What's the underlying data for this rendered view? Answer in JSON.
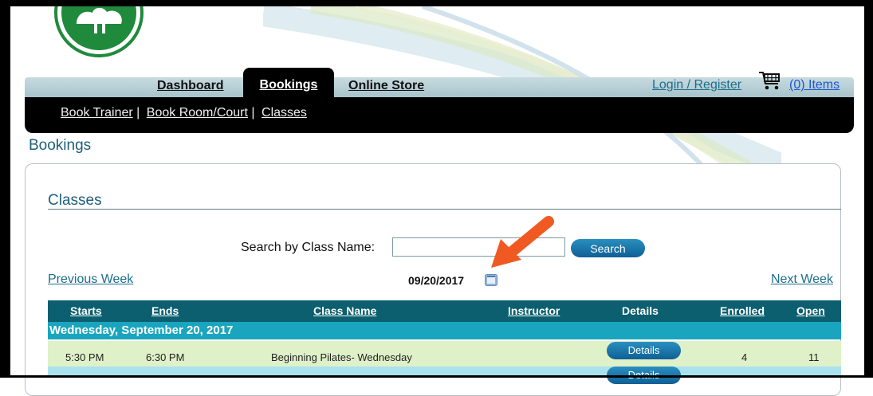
{
  "nav": {
    "tabs": [
      {
        "label": "Dashboard"
      },
      {
        "label": "Bookings"
      },
      {
        "label": "Online Store"
      }
    ],
    "login_label": "Login / Register",
    "cart_items_label": "(0) Items"
  },
  "subnav": {
    "items": [
      {
        "label": "Book Trainer"
      },
      {
        "label": "Book Room/Court"
      },
      {
        "label": "Classes"
      }
    ],
    "separator": "|"
  },
  "page_heading": "Bookings",
  "classes": {
    "title": "Classes",
    "search_label": "Search by Class Name:",
    "search_value": "",
    "search_button": "Search",
    "prev_week": "Previous Week",
    "next_week": "Next Week",
    "date": "09/20/2017",
    "columns": [
      "Starts",
      "Ends",
      "Class Name",
      "Instructor",
      "Details",
      "Enrolled",
      "Open"
    ],
    "group_label": "Wednesday, September 20, 2017",
    "rows": [
      {
        "starts": "5:30 PM",
        "ends": "6:30 PM",
        "class_name": "Beginning Pilates- Wednesday",
        "instructor": "",
        "details": "Details",
        "enrolled": "4",
        "open": "11"
      },
      {
        "details": "Details"
      }
    ]
  },
  "icons": {
    "logo": "tree-logo",
    "cart": "shopping-cart-icon",
    "calendar": "calendar-icon",
    "annotation": "orange-arrow"
  },
  "colors": {
    "header_black": "#000000",
    "table_header": "#0b5f6f",
    "group_row": "#1aa5bf",
    "row_green": "#dff1c8",
    "row_blue": "#a9e2ee",
    "button_blue": "#1a76ad",
    "link_teal": "#1c6e8c",
    "arrow_orange": "#f05a22"
  }
}
